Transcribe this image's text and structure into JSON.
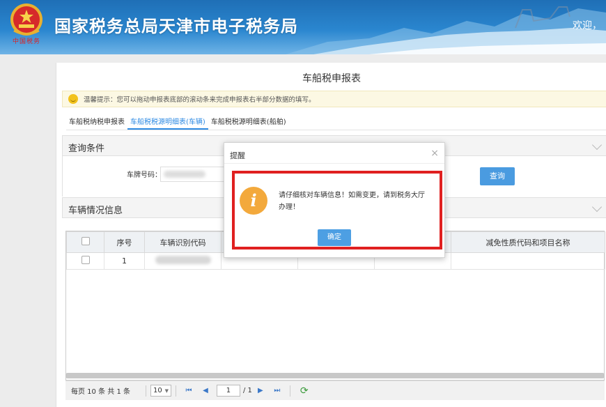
{
  "header": {
    "site_title": "国家税务总局天津市电子税务局",
    "emblem_caption": "中国税务",
    "welcome": "欢迎，"
  },
  "page": {
    "title": "车船税申报表",
    "notice": "温馨提示：您可以拖动申报表底部的滚动条来完成申报表右半部分数据的填写。",
    "tabs": [
      {
        "label": "车船税纳税申报表",
        "active": false
      },
      {
        "label": "车船税税源明细表(车辆)",
        "active": true
      },
      {
        "label": "车船税税源明细表(船舶)",
        "active": false
      }
    ]
  },
  "query": {
    "section_title": "查询条件",
    "plate_label": "车牌号码：",
    "plate_value": "",
    "query_button": "查询"
  },
  "vehicles": {
    "section_title": "车辆情况信息",
    "columns": [
      "",
      "序号",
      "车辆识别代码",
      "",
      "",
      "",
      "减免性质代码和项目名称"
    ],
    "rows": [
      {
        "seq": "1"
      }
    ]
  },
  "pager": {
    "per_page_text": "每页 10 条 共 1 条",
    "page_size": "10",
    "current_page": "1",
    "total_pages": "/ 1"
  },
  "dialog": {
    "title": "提醒",
    "message": "请仔细核对车辆信息！如需变更，请到税务大厅办理！",
    "ok_label": "确定",
    "close": "×"
  },
  "colors": {
    "header_blue": "#2a86cf",
    "accent_blue": "#4a9be0",
    "warning_red": "#e02020",
    "info_orange": "#f3a93c"
  }
}
